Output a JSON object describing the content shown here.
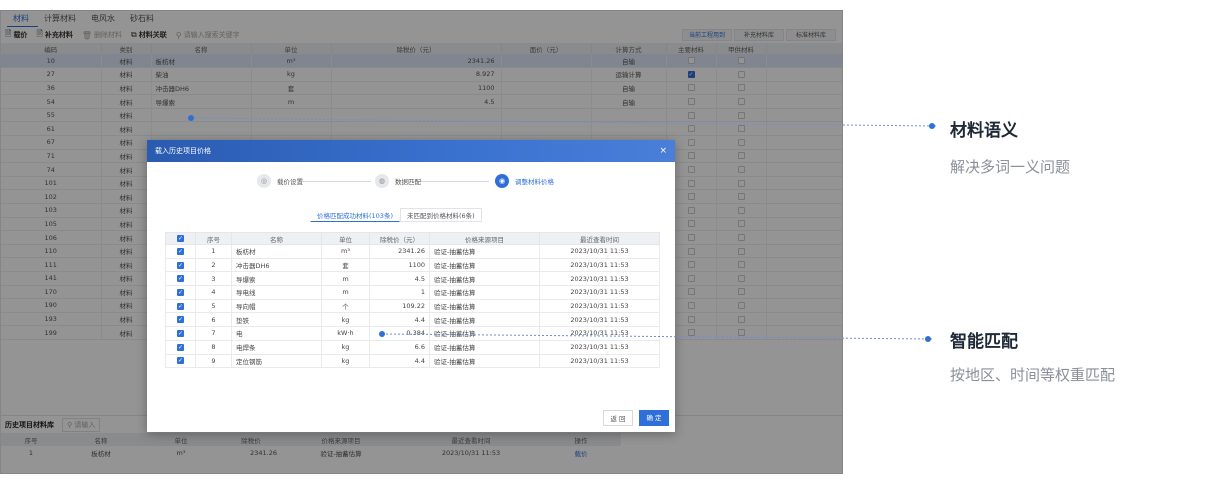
{
  "tabs": [
    "材料",
    "计算材料",
    "电风水",
    "砂石料"
  ],
  "toolbar": {
    "items": [
      "载价",
      "补充材料",
      "删除材料",
      "材料关联"
    ],
    "search_placeholder": "请输入搜索关键字",
    "right_tabs": [
      "当前工程用到",
      "补充材料库",
      "标准材料库"
    ]
  },
  "bg_table": {
    "headers": [
      "编码",
      "类别",
      "名称",
      "单位",
      "除税价（元）",
      "面价（元）",
      "计算方式",
      "主要材料",
      "甲供材料"
    ],
    "rows": [
      {
        "code": "10",
        "cat": "材料",
        "name": "板枋材",
        "unit": "m³",
        "price": "2341.26",
        "calc": "自输",
        "main": false
      },
      {
        "code": "27",
        "cat": "材料",
        "name": "柴油",
        "unit": "kg",
        "price": "8.927",
        "calc": "运输计算",
        "main": true
      },
      {
        "code": "36",
        "cat": "材料",
        "name": "冲击器DH6",
        "unit": "套",
        "price": "1100",
        "calc": "自输",
        "main": false
      },
      {
        "code": "54",
        "cat": "材料",
        "name": "导爆索",
        "unit": "m",
        "price": "4.5",
        "calc": "自输",
        "main": false
      },
      {
        "code": "55",
        "cat": "材料",
        "name": "",
        "unit": "",
        "price": "",
        "calc": "",
        "main": false
      },
      {
        "code": "61",
        "cat": "材料",
        "name": "",
        "unit": "",
        "price": "",
        "calc": "",
        "main": false
      },
      {
        "code": "67",
        "cat": "材料",
        "name": "",
        "unit": "",
        "price": "",
        "calc": "",
        "main": false
      },
      {
        "code": "71",
        "cat": "材料",
        "name": "",
        "unit": "",
        "price": "",
        "calc": "",
        "main": false
      },
      {
        "code": "74",
        "cat": "材料",
        "name": "",
        "unit": "",
        "price": "",
        "calc": "",
        "main": false
      },
      {
        "code": "101",
        "cat": "材料",
        "name": "",
        "unit": "",
        "price": "",
        "calc": "",
        "main": false
      },
      {
        "code": "102",
        "cat": "材料",
        "name": "",
        "unit": "",
        "price": "",
        "calc": "",
        "main": false
      },
      {
        "code": "103",
        "cat": "材料",
        "name": "",
        "unit": "",
        "price": "",
        "calc": "",
        "main": false
      },
      {
        "code": "105",
        "cat": "材料",
        "name": "",
        "unit": "",
        "price": "",
        "calc": "",
        "main": false
      },
      {
        "code": "106",
        "cat": "材料",
        "name": "",
        "unit": "",
        "price": "",
        "calc": "",
        "main": false
      },
      {
        "code": "110",
        "cat": "材料",
        "name": "",
        "unit": "",
        "price": "",
        "calc": "",
        "main": false
      },
      {
        "code": "111",
        "cat": "材料",
        "name": "",
        "unit": "",
        "price": "",
        "calc": "",
        "main": false
      },
      {
        "code": "141",
        "cat": "材料",
        "name": "",
        "unit": "",
        "price": "",
        "calc": "",
        "main": false
      },
      {
        "code": "170",
        "cat": "材料",
        "name": "",
        "unit": "",
        "price": "",
        "calc": "",
        "main": false
      },
      {
        "code": "190",
        "cat": "材料",
        "name": "",
        "unit": "",
        "price": "",
        "calc": "",
        "main": false
      },
      {
        "code": "193",
        "cat": "材料",
        "name": "",
        "unit": "",
        "price": "",
        "calc": "",
        "main": false
      },
      {
        "code": "199",
        "cat": "材料",
        "name": "",
        "unit": "",
        "price": "",
        "calc": "",
        "main": false
      }
    ]
  },
  "history": {
    "title": "历史项目材料库",
    "search_placeholder": "请输入",
    "headers": [
      "序号",
      "名称",
      "单位",
      "除税价",
      "价格来源项目",
      "最近查看时间",
      "操作"
    ],
    "row": {
      "no": "1",
      "name": "板枋材",
      "unit": "m³",
      "price": "2341.26",
      "source": "验证-抽蓄估算",
      "time": "2023/10/31 11:53",
      "op": "载价"
    }
  },
  "modal": {
    "title": "载入历史项目价格",
    "close": "×",
    "steps": [
      "载价设置",
      "数据匹配",
      "调整材料价格"
    ],
    "subtabs": [
      "价格匹配成功材料(103条)",
      "未匹配到价格材料(6条)"
    ],
    "headers": [
      "序号",
      "名称",
      "单位",
      "除税价（元）",
      "价格来源项目",
      "最近查看时间"
    ],
    "rows": [
      {
        "no": "1",
        "name": "板枋材",
        "unit": "m³",
        "price": "2341.26",
        "source": "验证-抽蓄估算",
        "time": "2023/10/31 11:53"
      },
      {
        "no": "2",
        "name": "冲击器DH6",
        "unit": "套",
        "price": "1100",
        "source": "验证-抽蓄估算",
        "time": "2023/10/31 11:53"
      },
      {
        "no": "3",
        "name": "导爆索",
        "unit": "m",
        "price": "4.5",
        "source": "验证-抽蓄估算",
        "time": "2023/10/31 11:53"
      },
      {
        "no": "4",
        "name": "导电线",
        "unit": "m",
        "price": "1",
        "source": "验证-抽蓄估算",
        "time": "2023/10/31 11:53"
      },
      {
        "no": "5",
        "name": "导向帽",
        "unit": "个",
        "price": "109.22",
        "source": "验证-抽蓄估算",
        "time": "2023/10/31 11:53"
      },
      {
        "no": "6",
        "name": "垫铁",
        "unit": "kg",
        "price": "4.4",
        "source": "验证-抽蓄估算",
        "time": "2023/10/31 11:53"
      },
      {
        "no": "7",
        "name": "电",
        "unit": "kW·h",
        "price": "0.384",
        "source": "验证-抽蓄估算",
        "time": "2023/10/31 11:53"
      },
      {
        "no": "8",
        "name": "电焊条",
        "unit": "kg",
        "price": "6.6",
        "source": "验证-抽蓄估算",
        "time": "2023/10/31 11:53"
      },
      {
        "no": "9",
        "name": "定位钢筋",
        "unit": "kg",
        "price": "4.4",
        "source": "验证-抽蓄估算",
        "time": "2023/10/31 11:53"
      }
    ],
    "back": "返 回",
    "ok": "确 定"
  },
  "callouts": [
    {
      "title": "材料语义",
      "subtitle": "解决多词一义问题"
    },
    {
      "title": "智能匹配",
      "subtitle": "按地区、时间等权重匹配"
    }
  ],
  "colors": {
    "accent": "#2f6fd8",
    "header": "#2a5bb0"
  }
}
